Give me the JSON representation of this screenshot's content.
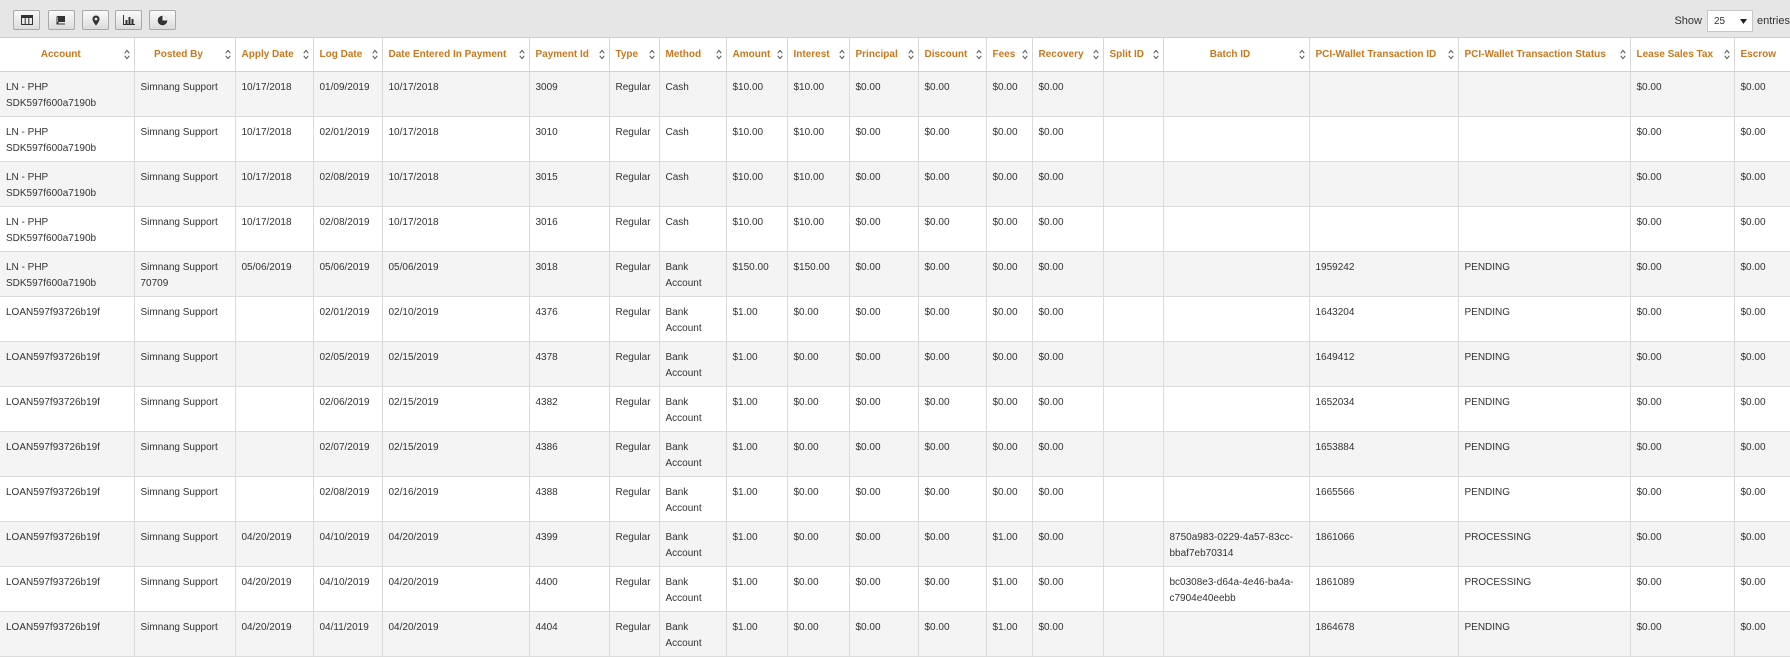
{
  "toolbar": {
    "buttons": [
      {
        "name": "columns-icon"
      },
      {
        "name": "book-icon"
      },
      {
        "name": "map-pin-icon"
      },
      {
        "name": "bar-chart-icon"
      },
      {
        "name": "pie-chart-icon"
      }
    ],
    "show_label": "Show",
    "entries_value": "25",
    "entries_label": "entries"
  },
  "table": {
    "columns": [
      "Account",
      "Posted By",
      "Apply Date",
      "Log Date",
      "Date Entered In Payment",
      "Payment Id",
      "Type",
      "Method",
      "Amount",
      "Interest",
      "Principal",
      "Discount",
      "Fees",
      "Recovery",
      "Split ID",
      "Batch ID",
      "PCI-Wallet Transaction ID",
      "PCI-Wallet Transaction Status",
      "Lease Sales Tax",
      "Escrow"
    ],
    "rows": [
      [
        "LN - PHP SDK597f600a7190b",
        "Simnang Support",
        "10/17/2018",
        "01/09/2019",
        "10/17/2018",
        "3009",
        "Regular",
        "Cash",
        "$10.00",
        "$10.00",
        "$0.00",
        "$0.00",
        "$0.00",
        "$0.00",
        "",
        "",
        "",
        "",
        "$0.00",
        "$0.00"
      ],
      [
        "LN - PHP SDK597f600a7190b",
        "Simnang Support",
        "10/17/2018",
        "02/01/2019",
        "10/17/2018",
        "3010",
        "Regular",
        "Cash",
        "$10.00",
        "$10.00",
        "$0.00",
        "$0.00",
        "$0.00",
        "$0.00",
        "",
        "",
        "",
        "",
        "$0.00",
        "$0.00"
      ],
      [
        "LN - PHP SDK597f600a7190b",
        "Simnang Support",
        "10/17/2018",
        "02/08/2019",
        "10/17/2018",
        "3015",
        "Regular",
        "Cash",
        "$10.00",
        "$10.00",
        "$0.00",
        "$0.00",
        "$0.00",
        "$0.00",
        "",
        "",
        "",
        "",
        "$0.00",
        "$0.00"
      ],
      [
        "LN - PHP SDK597f600a7190b",
        "Simnang Support",
        "10/17/2018",
        "02/08/2019",
        "10/17/2018",
        "3016",
        "Regular",
        "Cash",
        "$10.00",
        "$10.00",
        "$0.00",
        "$0.00",
        "$0.00",
        "$0.00",
        "",
        "",
        "",
        "",
        "$0.00",
        "$0.00"
      ],
      [
        "LN - PHP SDK597f600a7190b",
        "Simnang Support 70709",
        "05/06/2019",
        "05/06/2019",
        "05/06/2019",
        "3018",
        "Regular",
        "Bank Account",
        "$150.00",
        "$150.00",
        "$0.00",
        "$0.00",
        "$0.00",
        "$0.00",
        "",
        "",
        "1959242",
        "PENDING",
        "$0.00",
        "$0.00"
      ],
      [
        "LOAN597f93726b19f",
        "Simnang Support",
        "",
        "02/01/2019",
        "02/10/2019",
        "4376",
        "Regular",
        "Bank Account",
        "$1.00",
        "$0.00",
        "$0.00",
        "$0.00",
        "$0.00",
        "$0.00",
        "",
        "",
        "1643204",
        "PENDING",
        "$0.00",
        "$0.00"
      ],
      [
        "LOAN597f93726b19f",
        "Simnang Support",
        "",
        "02/05/2019",
        "02/15/2019",
        "4378",
        "Regular",
        "Bank Account",
        "$1.00",
        "$0.00",
        "$0.00",
        "$0.00",
        "$0.00",
        "$0.00",
        "",
        "",
        "1649412",
        "PENDING",
        "$0.00",
        "$0.00"
      ],
      [
        "LOAN597f93726b19f",
        "Simnang Support",
        "",
        "02/06/2019",
        "02/15/2019",
        "4382",
        "Regular",
        "Bank Account",
        "$1.00",
        "$0.00",
        "$0.00",
        "$0.00",
        "$0.00",
        "$0.00",
        "",
        "",
        "1652034",
        "PENDING",
        "$0.00",
        "$0.00"
      ],
      [
        "LOAN597f93726b19f",
        "Simnang Support",
        "",
        "02/07/2019",
        "02/15/2019",
        "4386",
        "Regular",
        "Bank Account",
        "$1.00",
        "$0.00",
        "$0.00",
        "$0.00",
        "$0.00",
        "$0.00",
        "",
        "",
        "1653884",
        "PENDING",
        "$0.00",
        "$0.00"
      ],
      [
        "LOAN597f93726b19f",
        "Simnang Support",
        "",
        "02/08/2019",
        "02/16/2019",
        "4388",
        "Regular",
        "Bank Account",
        "$1.00",
        "$0.00",
        "$0.00",
        "$0.00",
        "$0.00",
        "$0.00",
        "",
        "",
        "1665566",
        "PENDING",
        "$0.00",
        "$0.00"
      ],
      [
        "LOAN597f93726b19f",
        "Simnang Support",
        "04/20/2019",
        "04/10/2019",
        "04/20/2019",
        "4399",
        "Regular",
        "Bank Account",
        "$1.00",
        "$0.00",
        "$0.00",
        "$0.00",
        "$1.00",
        "$0.00",
        "",
        "8750a983-0229-4a57-83cc-bbaf7eb70314",
        "1861066",
        "PROCESSING",
        "$0.00",
        "$0.00"
      ],
      [
        "LOAN597f93726b19f",
        "Simnang Support",
        "04/20/2019",
        "04/10/2019",
        "04/20/2019",
        "4400",
        "Regular",
        "Bank Account",
        "$1.00",
        "$0.00",
        "$0.00",
        "$0.00",
        "$1.00",
        "$0.00",
        "",
        "bc0308e3-d64a-4e46-ba4a-c7904e40eebb",
        "1861089",
        "PROCESSING",
        "$0.00",
        "$0.00"
      ],
      [
        "LOAN597f93726b19f",
        "Simnang Support",
        "04/20/2019",
        "04/11/2019",
        "04/20/2019",
        "4404",
        "Regular",
        "Bank Account",
        "$1.00",
        "$0.00",
        "$0.00",
        "$0.00",
        "$1.00",
        "$0.00",
        "",
        "",
        "1864678",
        "PENDING",
        "$0.00",
        "$0.00"
      ]
    ]
  },
  "colors": {
    "header_text": "#c6791f",
    "toolbar_bg": "#e6e6e6",
    "row_stripe": "#f4f4f4"
  }
}
